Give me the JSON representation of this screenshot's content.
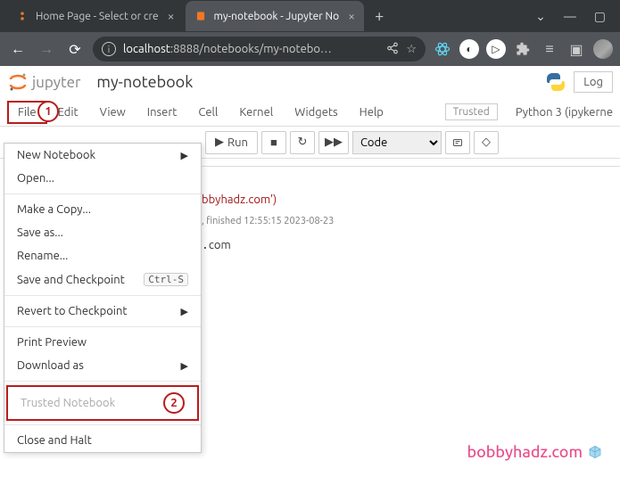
{
  "browser": {
    "tabs": [
      {
        "title": "Home Page - Select or cre",
        "active": false
      },
      {
        "title": "my-notebook - Jupyter No",
        "active": true
      }
    ],
    "url_host": "localhost",
    "url_path": ":8888/notebooks/my-notebo…"
  },
  "jupyter": {
    "brand": "jupyter",
    "notebook_name": "my-notebook",
    "login_label": "Log"
  },
  "menubar": {
    "items": [
      "File",
      "Edit",
      "View",
      "Insert",
      "Cell",
      "Kernel",
      "Widgets",
      "Help"
    ],
    "trusted_label": "Trusted",
    "kernel_label": "Python 3 (ipykerne"
  },
  "toolbar": {
    "run_label": "Run",
    "cell_type": "Code"
  },
  "dropdown": {
    "new_notebook": "New Notebook",
    "open": "Open...",
    "make_copy": "Make a Copy...",
    "save_as": "Save as...",
    "rename": "Rename...",
    "save_chk": "Save and Checkpoint",
    "save_chk_kbd": "Ctrl-S",
    "revert": "Revert to Checkpoint",
    "print": "Print Preview",
    "download": "Download as",
    "trusted": "Trusted Notebook",
    "close": "Close and Halt"
  },
  "annotations": {
    "one": "1",
    "two": "2"
  },
  "cell": {
    "code_fragment": "bbyhadz.com')",
    "exec_info": ", finished 12:55:15 2023-08-23",
    "output": "com"
  },
  "watermark": "bobbyhadz.com"
}
